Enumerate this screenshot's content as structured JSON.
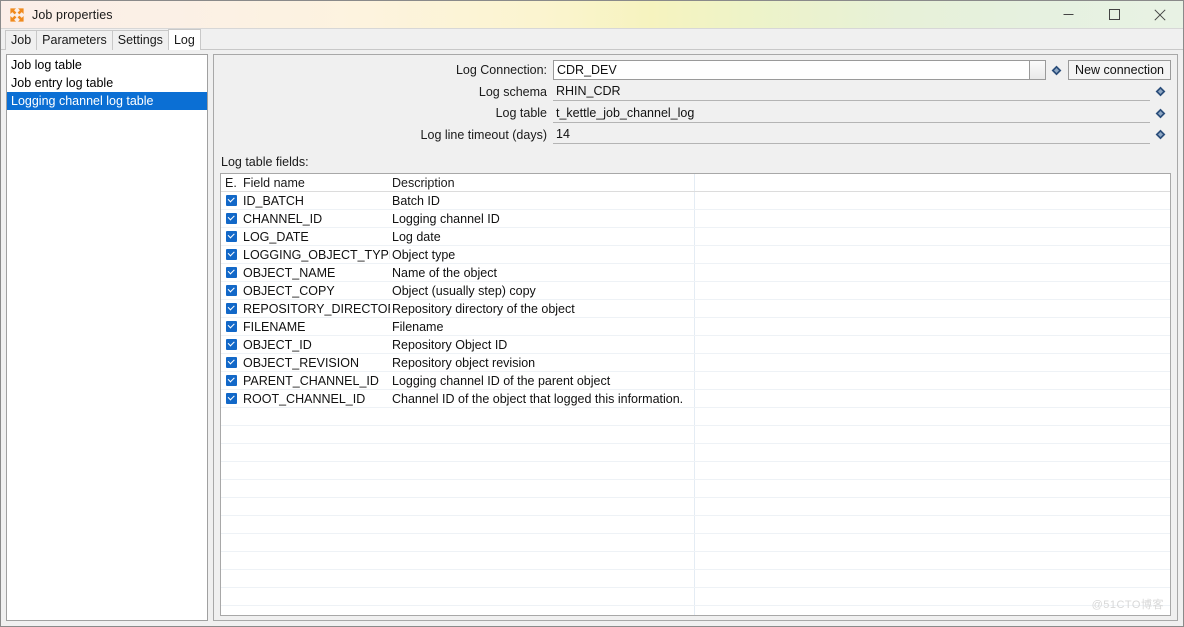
{
  "window": {
    "title": "Job properties",
    "icon": "expand-arrows-icon",
    "controls": {
      "minimize": "minimize-icon",
      "maximize": "maximize-icon",
      "close": "close-icon"
    }
  },
  "tabs": [
    {
      "label": "Job",
      "active": false
    },
    {
      "label": "Parameters",
      "active": false
    },
    {
      "label": "Settings",
      "active": false
    },
    {
      "label": "Log",
      "active": true
    }
  ],
  "sidebar": {
    "items": [
      {
        "label": "Job log table",
        "selected": false
      },
      {
        "label": "Job entry log table",
        "selected": false
      },
      {
        "label": "Logging channel log table",
        "selected": true
      }
    ]
  },
  "form": {
    "rows": [
      {
        "label": "Log Connection:",
        "value": "CDR_DEV",
        "style": "boxed",
        "combo": true,
        "variable": true,
        "button": "New connection"
      },
      {
        "label": "Log schema",
        "value": "RHIN_CDR",
        "style": "underline",
        "combo": false,
        "variable": true,
        "button": null
      },
      {
        "label": "Log table",
        "value": "t_kettle_job_channel_log",
        "style": "underline",
        "combo": false,
        "variable": true,
        "button": null
      },
      {
        "label": "Log line timeout (days)",
        "value": "14",
        "style": "underline",
        "combo": false,
        "variable": true,
        "button": null
      }
    ],
    "new_connection_label": "New connection",
    "fields_label": "Log table fields:"
  },
  "table": {
    "columns": [
      "E.",
      "Field name",
      "Description",
      ""
    ],
    "rows": [
      {
        "enabled": true,
        "name": "ID_BATCH",
        "description": "Batch ID"
      },
      {
        "enabled": true,
        "name": "CHANNEL_ID",
        "description": "Logging channel ID"
      },
      {
        "enabled": true,
        "name": "LOG_DATE",
        "description": "Log date"
      },
      {
        "enabled": true,
        "name": "LOGGING_OBJECT_TYPE",
        "description": "Object type"
      },
      {
        "enabled": true,
        "name": "OBJECT_NAME",
        "description": "Name of the object"
      },
      {
        "enabled": true,
        "name": "OBJECT_COPY",
        "description": "Object (usually step) copy"
      },
      {
        "enabled": true,
        "name": "REPOSITORY_DIRECTORY",
        "description": "Repository directory of the object"
      },
      {
        "enabled": true,
        "name": "FILENAME",
        "description": "Filename"
      },
      {
        "enabled": true,
        "name": "OBJECT_ID",
        "description": "Repository Object ID"
      },
      {
        "enabled": true,
        "name": "OBJECT_REVISION",
        "description": "Repository object revision"
      },
      {
        "enabled": true,
        "name": "PARENT_CHANNEL_ID",
        "description": "Logging channel ID of the parent object"
      },
      {
        "enabled": true,
        "name": "ROOT_CHANNEL_ID",
        "description": "Channel ID of the object that logged this information."
      }
    ],
    "empty_rows": 12
  },
  "watermark": "@51CTO博客",
  "colors": {
    "selection": "#0b6fd4",
    "checkbox": "#1268c8",
    "accent_icon": "#f08a1e",
    "variable_icon": "#2a4d7a"
  }
}
